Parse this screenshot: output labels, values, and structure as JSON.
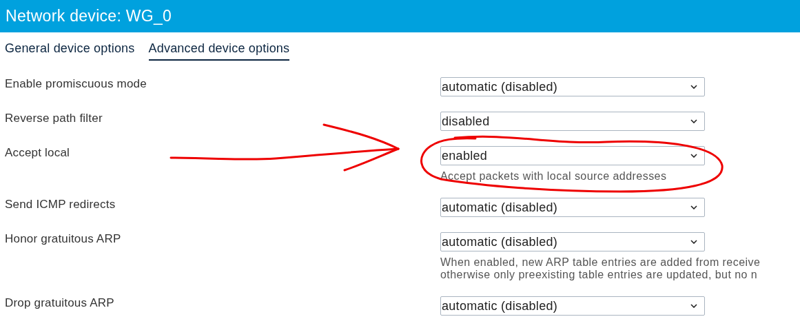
{
  "header": {
    "title": "Network device: WG_0"
  },
  "tabs": [
    {
      "label": "General device options",
      "selected": false
    },
    {
      "label": "Advanced device options",
      "selected": true
    }
  ],
  "options": [
    {
      "label": "Enable promiscuous mode",
      "value": "automatic (disabled)"
    },
    {
      "label": "Reverse path filter",
      "value": "disabled"
    },
    {
      "label": "Accept local",
      "value": "enabled",
      "description": [
        "Accept packets with local source addresses"
      ]
    },
    {
      "label": "Send ICMP redirects",
      "value": "automatic (disabled)"
    },
    {
      "label": "Honor gratuitous ARP",
      "value": "automatic (disabled)",
      "description": [
        "When enabled, new ARP table entries are added from receive",
        "otherwise only preexisting table entries are updated, but no n"
      ]
    },
    {
      "label": "Drop gratuitous ARP",
      "value": "automatic (disabled)"
    }
  ],
  "annotations": {
    "arrow": true,
    "ellipse": true
  }
}
